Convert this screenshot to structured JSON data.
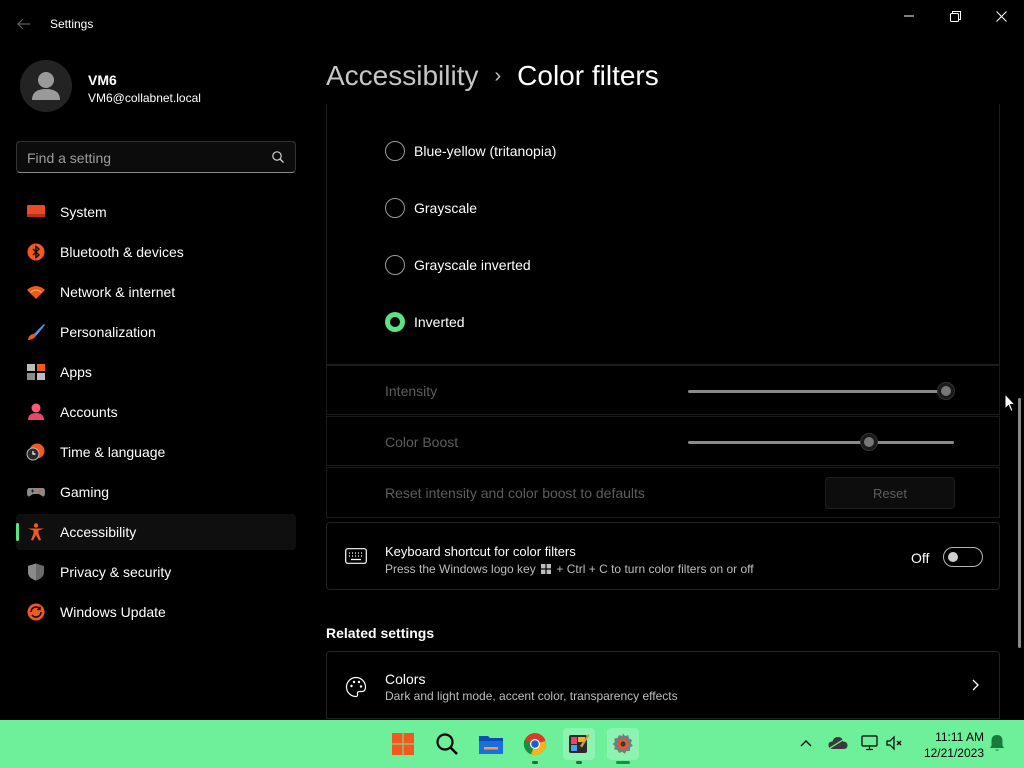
{
  "window": {
    "title": "Settings",
    "back_icon": "back-arrow-icon",
    "minimize_icon": "minimize-icon",
    "maximize_icon": "restore-icon",
    "close_icon": "close-icon"
  },
  "user": {
    "name": "VM6",
    "email": "VM6@collabnet.local"
  },
  "search": {
    "placeholder": "Find a setting",
    "value": ""
  },
  "sidebar": {
    "items": [
      {
        "label": "System",
        "icon": "system-icon",
        "active": false
      },
      {
        "label": "Bluetooth & devices",
        "icon": "bluetooth-icon",
        "active": false
      },
      {
        "label": "Network & internet",
        "icon": "wifi-icon",
        "active": false
      },
      {
        "label": "Personalization",
        "icon": "brush-icon",
        "active": false
      },
      {
        "label": "Apps",
        "icon": "apps-icon",
        "active": false
      },
      {
        "label": "Accounts",
        "icon": "accounts-icon",
        "active": false
      },
      {
        "label": "Time & language",
        "icon": "clock-globe-icon",
        "active": false
      },
      {
        "label": "Gaming",
        "icon": "gamepad-icon",
        "active": false
      },
      {
        "label": "Accessibility",
        "icon": "accessibility-icon",
        "active": true
      },
      {
        "label": "Privacy & security",
        "icon": "shield-icon",
        "active": false
      },
      {
        "label": "Windows Update",
        "icon": "update-icon",
        "active": false
      }
    ],
    "accent_color": "#5fe085"
  },
  "breadcrumb": {
    "parent": "Accessibility",
    "separator": "›",
    "current": "Color filters"
  },
  "filters": {
    "options": [
      {
        "label": "Blue-yellow (tritanopia)",
        "checked": false
      },
      {
        "label": "Grayscale",
        "checked": false
      },
      {
        "label": "Grayscale inverted",
        "checked": false
      },
      {
        "label": "Inverted",
        "checked": true
      }
    ]
  },
  "intensity": {
    "label": "Intensity",
    "value_fraction": 0.97,
    "enabled": false
  },
  "color_boost": {
    "label": "Color Boost",
    "value_fraction": 0.68,
    "enabled": false
  },
  "reset": {
    "label": "Reset intensity and color boost to defaults",
    "button": "Reset"
  },
  "keyboard_shortcut": {
    "title": "Keyboard shortcut for color filters",
    "desc_before": "Press the Windows logo key",
    "desc_after": "+ Ctrl + C to turn color filters on or off",
    "state": "Off",
    "on": false,
    "icon": "keyboard-icon"
  },
  "related": {
    "heading": "Related settings",
    "items": [
      {
        "title": "Colors",
        "desc": "Dark and light mode, accent color, transparency effects",
        "icon": "palette-icon"
      }
    ]
  },
  "taskbar": {
    "background": "#6ef09a",
    "apps": [
      {
        "name": "start-icon",
        "active": false,
        "running": false
      },
      {
        "name": "search-icon",
        "active": false,
        "running": false
      },
      {
        "name": "file-explorer-icon",
        "active": false,
        "running": false
      },
      {
        "name": "chrome-icon",
        "active": false,
        "running": true
      },
      {
        "name": "paint-icon",
        "active": true,
        "running": true
      },
      {
        "name": "settings-icon",
        "active": true,
        "running": true
      }
    ],
    "tray": [
      "chevron-up-icon",
      "cloud-icon",
      "network-icon",
      "volume-mute-icon"
    ],
    "time": "11:11 AM",
    "date": "12/21/2023",
    "notification_icon": "bell-icon"
  }
}
